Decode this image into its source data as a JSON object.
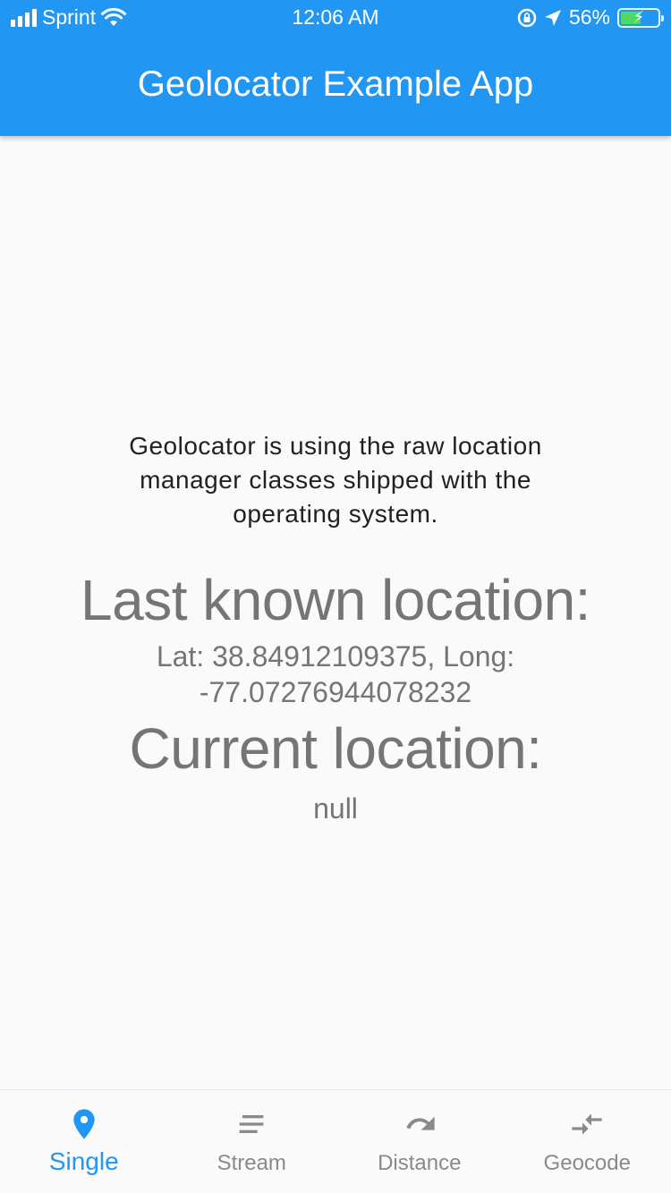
{
  "status_bar": {
    "carrier": "Sprint",
    "time": "12:06 AM",
    "battery_percent": "56%",
    "battery_level": 0.56
  },
  "app_bar": {
    "title": "Geolocator Example App"
  },
  "main": {
    "description": "Geolocator is using the raw location manager classes shipped with the operating system.",
    "last_known_heading": "Last known location:",
    "last_known_value": "Lat: 38.84912109375, Long: -77.07276944078232",
    "current_heading": "Current location:",
    "current_value": "null"
  },
  "bottom_nav": {
    "items": [
      {
        "label": "Single",
        "icon": "location-pin-icon",
        "active": true
      },
      {
        "label": "Stream",
        "icon": "stream-lines-icon",
        "active": false
      },
      {
        "label": "Distance",
        "icon": "redo-arrow-icon",
        "active": false
      },
      {
        "label": "Geocode",
        "icon": "compare-arrows-icon",
        "active": false
      }
    ]
  },
  "colors": {
    "primary": "#2196f3",
    "background": "#fafafa",
    "secondary_text": "#757575",
    "inactive_nav": "#8a8a8a",
    "battery_green": "#4cd964"
  }
}
